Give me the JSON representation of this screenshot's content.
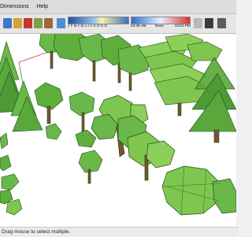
{
  "menu": {
    "items": [
      "Dimensions",
      "Help"
    ]
  },
  "shadows": {
    "months": "J F M A M J J A S O N D",
    "time_start": "04:38 AM",
    "time_noon": "Noon",
    "time_end": "04:51 PM"
  },
  "status_bar": {
    "text": "Drag mouse to select multiple."
  },
  "colors": {
    "foliage": "#5fae3c",
    "foliage_dark": "#2f6b1f",
    "trunk": "#7a5232",
    "axis_red": "#e03030",
    "axis_green": "#2a9b2a"
  },
  "icons": {
    "toolbar": [
      "select-arrow-icon",
      "push-pull-icon",
      "move-icon",
      "orbit-icon",
      "pan-icon",
      "zoom-icon",
      "shadow-settings-icon",
      "fog-icon",
      "shadows-toggle-icon"
    ]
  }
}
